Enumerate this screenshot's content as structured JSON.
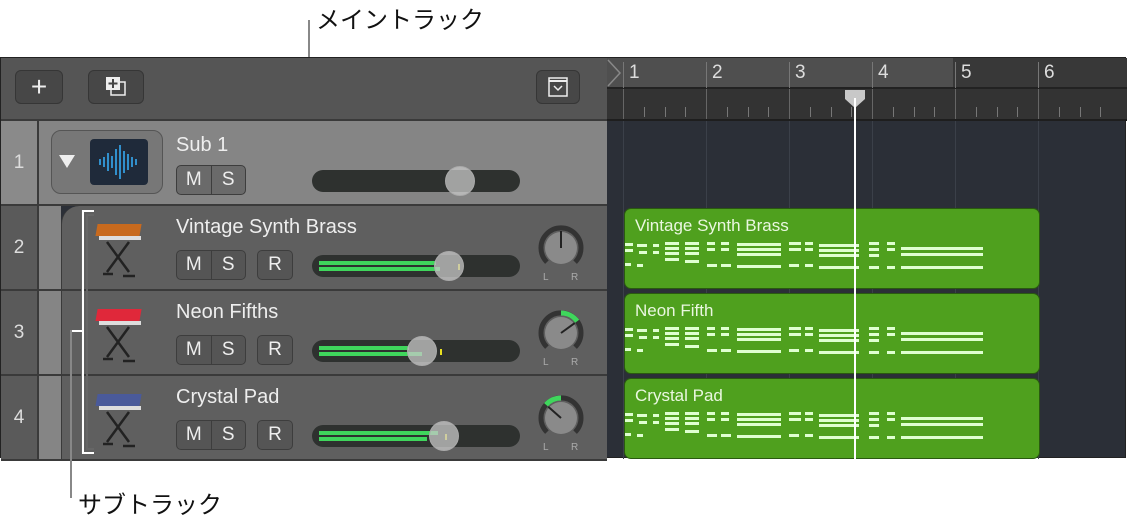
{
  "callouts": {
    "main_track": "メイントラック",
    "sub_tracks": "サブトラック"
  },
  "toolbar": {
    "add_track": "add-track",
    "duplicate_track": "duplicate-track",
    "collapse": "collapse"
  },
  "ruler": {
    "bars": [
      "1",
      "2",
      "3",
      "4",
      "5",
      "6"
    ],
    "playhead_bar": 3.8
  },
  "tracks": [
    {
      "number": "1",
      "name": "Sub 1",
      "type": "summing-stack",
      "volume": 0.72,
      "buttons": [
        "M",
        "S"
      ]
    },
    {
      "number": "2",
      "name": "Vintage Synth Brass",
      "volume": 0.64,
      "pan": 0.5,
      "buttons": [
        "M",
        "S",
        "R"
      ],
      "meter": [
        0.65,
        0.67
      ]
    },
    {
      "number": "3",
      "name": "Neon Fifths",
      "volume": 0.49,
      "pan": 0.7,
      "buttons": [
        "M",
        "S",
        "R"
      ],
      "meter": [
        0.5,
        0.57
      ]
    },
    {
      "number": "4",
      "name": "Crystal Pad",
      "volume": 0.61,
      "pan": 0.32,
      "buttons": [
        "M",
        "S",
        "R"
      ],
      "meter": [
        0.66,
        0.6
      ]
    }
  ],
  "pan_labels": {
    "left": "L",
    "right": "R"
  },
  "regions": [
    {
      "name": "Vintage Synth Brass",
      "color": "#4fa01e"
    },
    {
      "name": "Neon Fifth",
      "color": "#4fa01e"
    },
    {
      "name": "Crystal Pad",
      "color": "#4fa01e"
    }
  ]
}
